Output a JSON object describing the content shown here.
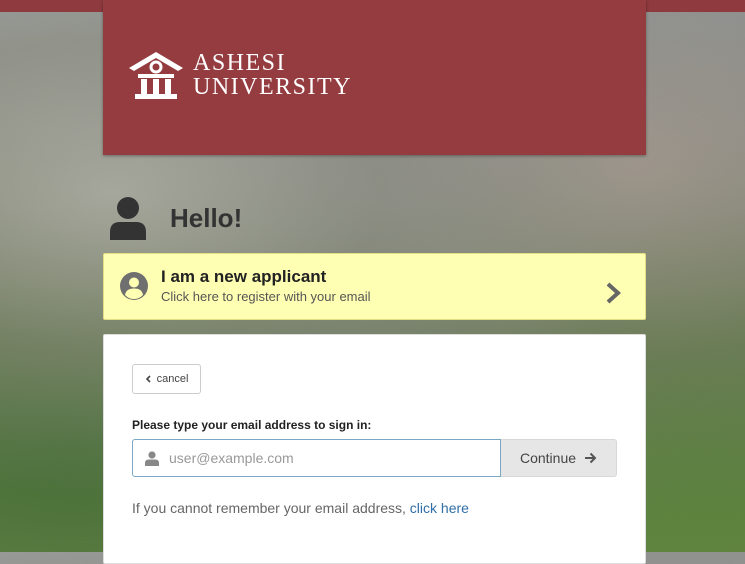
{
  "brand": {
    "line1": "ASHESI",
    "line2": "UNIVERSITY",
    "color": "#943c40",
    "logo_icon": "ashesi-building-icon"
  },
  "greeting": "Hello!",
  "new_applicant": {
    "title": "I am a new applicant",
    "subtitle": "Click here to register with your email",
    "background": "#ffffb3"
  },
  "signin": {
    "cancel_label": "cancel",
    "prompt": "Please type your email address to sign in:",
    "email_placeholder": "user@example.com",
    "email_value": "",
    "continue_label": "Continue",
    "forgot_text": "If you cannot remember your email address,",
    "forgot_link": "click here",
    "link_color": "#2f6ea6"
  }
}
